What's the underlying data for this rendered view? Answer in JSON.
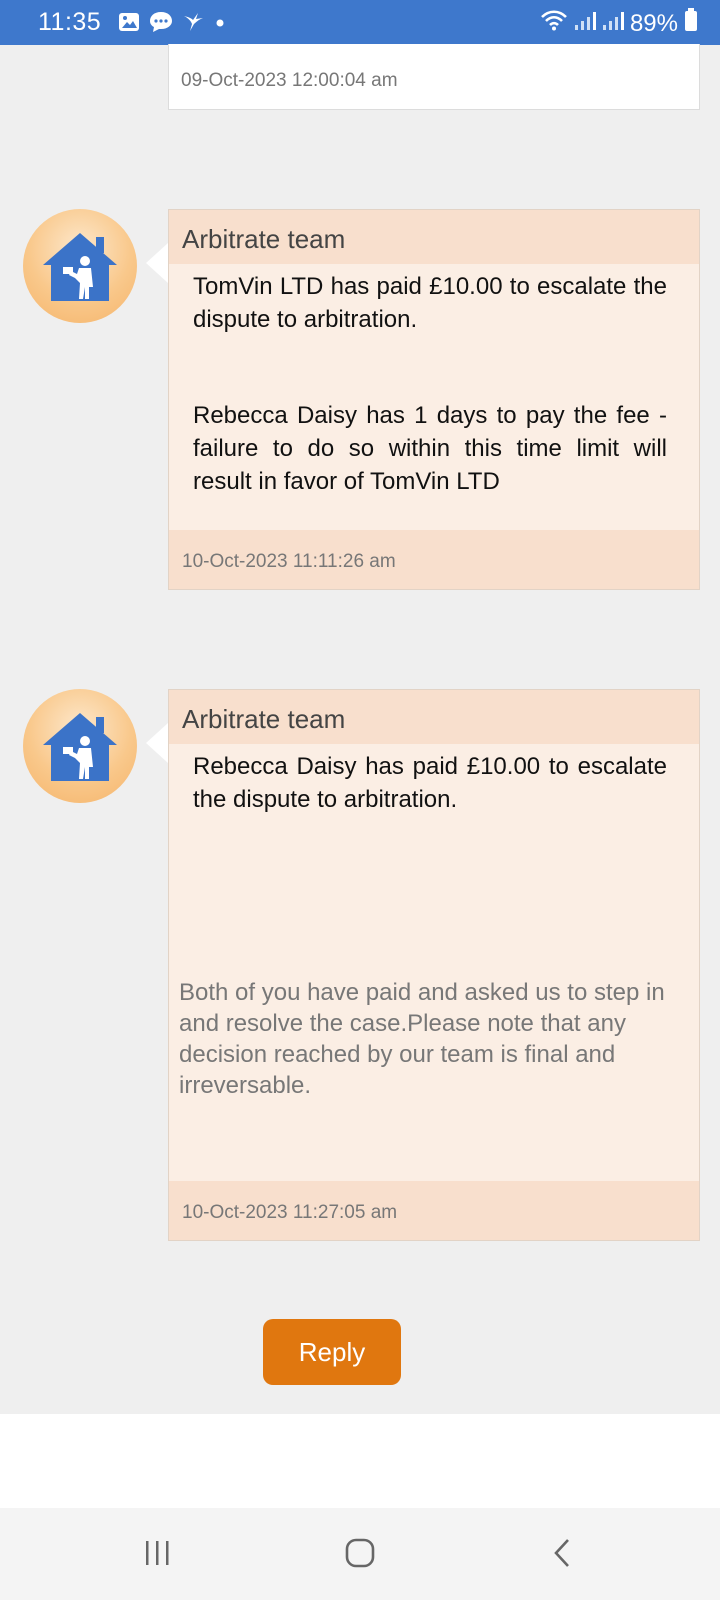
{
  "status_bar": {
    "time": "11:35",
    "battery": "89%",
    "notification_icons": [
      "gallery-icon",
      "chat-icon",
      "bird-icon",
      "dot-icon"
    ]
  },
  "previous_message": {
    "timestamp": "09-Oct-2023 12:00:04 am"
  },
  "messages": [
    {
      "sender": "Arbitrate team",
      "body_paragraph_1": "TomVin LTD has paid £10.00 to escalate the dispute to arbitration.",
      "body_paragraph_2": "Rebecca Daisy has 1 days to pay the fee - failure to do so within this time limit will result in favor of TomVin LTD",
      "timestamp": "10-Oct-2023 11:11:26 am"
    },
    {
      "sender": "Arbitrate team",
      "body_paragraph_1": "Rebecca Daisy has paid £10.00 to escalate the dispute to arbitration.",
      "body_paragraph_2": "Both of you have paid and asked us to step in and resolve the case.Please note that any decision reached by our team is final and irreversable.",
      "timestamp": "10-Oct-2023 11:27:05 am"
    }
  ],
  "reply_button": "Reply",
  "colors": {
    "status_bar": "#3e78cc",
    "card_header": "#f8dfcd",
    "card_body": "#fbeee4",
    "reply_button": "#e0770f",
    "avatar_house": "#3b73c8"
  }
}
